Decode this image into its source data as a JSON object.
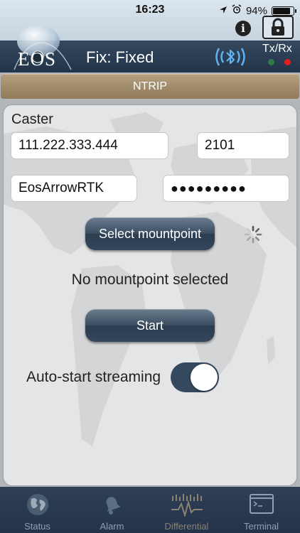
{
  "status_bar": {
    "time": "16:23",
    "battery_percent": "94%",
    "battery_level": 0.94
  },
  "header": {
    "logo_text": "EOS",
    "title": "Fix: Fixed",
    "txrx_label": "Tx/Rx",
    "tx_led_color": "#2f7a4a",
    "rx_led_color": "#e02020"
  },
  "section": {
    "title": "NTRIP"
  },
  "caster": {
    "label": "Caster",
    "host": "111.222.333.444",
    "port": "2101",
    "username": "EosArrowRTK",
    "password_mask": "●●●●●●●●●"
  },
  "mountpoint": {
    "button_label": "Select mountpoint",
    "status": "No mountpoint selected"
  },
  "start_button": {
    "label": "Start"
  },
  "auto_start": {
    "label": "Auto-start streaming",
    "enabled": true
  },
  "tabs": [
    {
      "label": "Status",
      "icon": "globe-icon"
    },
    {
      "label": "Alarm",
      "icon": "bell-icon"
    },
    {
      "label": "Differential",
      "icon": "waveform-icon",
      "active": true
    },
    {
      "label": "Terminal",
      "icon": "terminal-icon"
    }
  ],
  "colors": {
    "accent": "#34485e",
    "section_bar": "#a28e6c",
    "tab_active": "#8c8271"
  }
}
